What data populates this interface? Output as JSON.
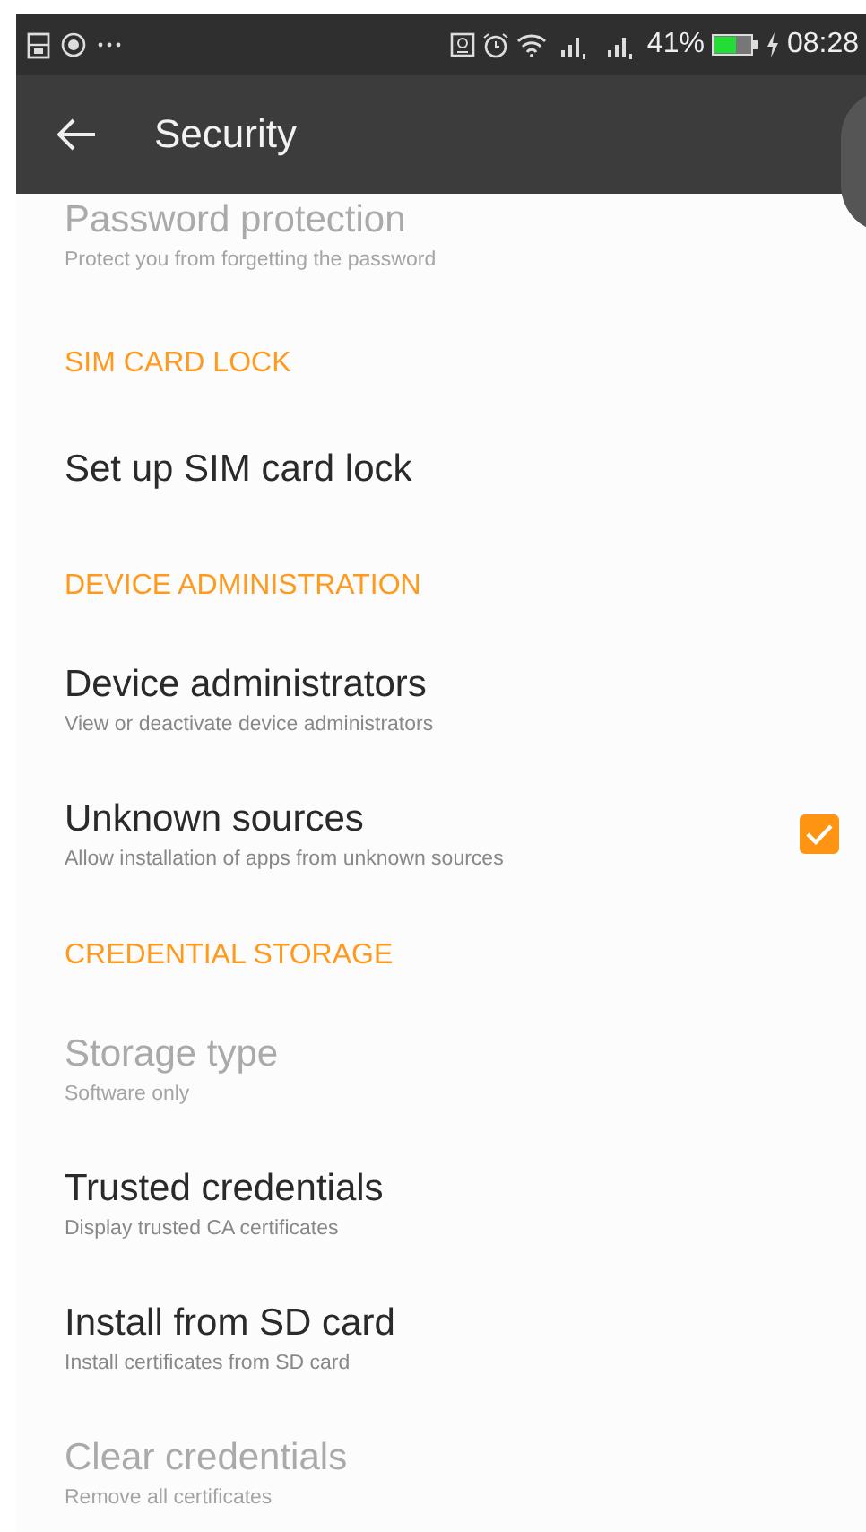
{
  "status_bar": {
    "battery": "41%",
    "time": "08:28"
  },
  "toolbar": {
    "title": "Security"
  },
  "entries": [
    {
      "kind": "preference",
      "title": "Password protection",
      "summary": "Protect you from forgetting the password",
      "disabled": true
    },
    {
      "kind": "header",
      "title": "SIM CARD LOCK"
    },
    {
      "kind": "preference",
      "title": "Set up SIM card lock",
      "disabled": false
    },
    {
      "kind": "header",
      "title": "DEVICE ADMINISTRATION"
    },
    {
      "kind": "preference",
      "title": "Device administrators",
      "summary": "View or deactivate device administrators",
      "disabled": false
    },
    {
      "kind": "checkbox",
      "title": "Unknown sources",
      "summary": "Allow installation of apps from unknown sources",
      "disabled": false,
      "checked": true
    },
    {
      "kind": "header",
      "title": "CREDENTIAL STORAGE"
    },
    {
      "kind": "preference",
      "title": "Storage type",
      "summary": "Software only",
      "disabled": true
    },
    {
      "kind": "preference",
      "title": "Trusted credentials",
      "summary": "Display trusted CA certificates",
      "disabled": false
    },
    {
      "kind": "preference",
      "title": "Install from SD card",
      "summary": "Install certificates from SD card",
      "disabled": false
    },
    {
      "kind": "preference",
      "title": "Clear credentials",
      "summary": "Remove all certificates",
      "disabled": true
    }
  ]
}
